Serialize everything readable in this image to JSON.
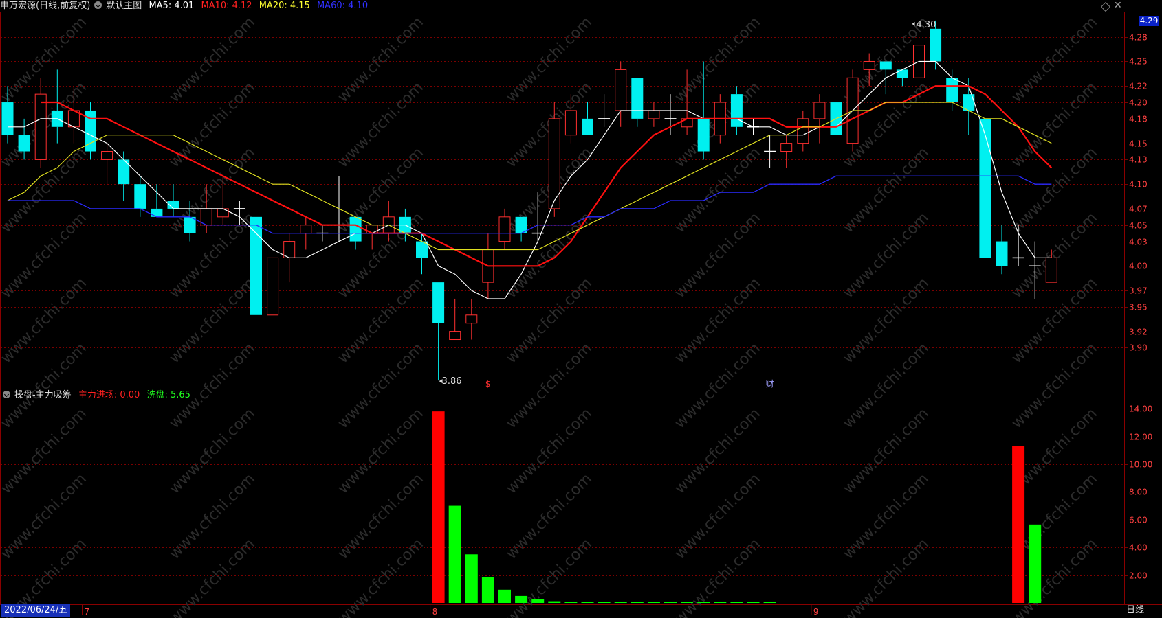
{
  "header": {
    "stock": "申万宏源(日线,前复权)",
    "main_chart": "默认主图",
    "ma5_label": "MA5:",
    "ma5_value": "4.01",
    "ma5_color": "#ffffff",
    "ma10_label": "MA10:",
    "ma10_value": "4.12",
    "ma10_color": "#ff2020",
    "ma20_label": "MA20:",
    "ma20_value": "4.15",
    "ma20_color": "#ffff30",
    "ma60_label": "MA60:",
    "ma60_value": "4.10",
    "ma60_color": "#2020ff"
  },
  "sub_header": {
    "indicator": "操盘-主力吸筹",
    "main_entry_label": "主力进场:",
    "main_entry_value": "0.00",
    "wash_label": "洗盘:",
    "wash_value": "5.65"
  },
  "current_price": "4.29",
  "date_label": "2022/06/24/五",
  "period_label": "日线",
  "month_ticks": [
    "7",
    "8",
    "9"
  ],
  "markers": {
    "high": "4.30",
    "low": "3.86",
    "event1": "$",
    "event2": "财"
  },
  "watermark": "www.cfchi.com",
  "colors": {
    "up": "#ff3030",
    "down": "#00f0f0",
    "grid": "#7a0000",
    "axis_text": "#ff4040",
    "bar_red": "#ff0000",
    "bar_green": "#00ff00"
  },
  "chart_data": [
    {
      "type": "candlestick",
      "title": "申万宏源(日线,前复权)",
      "ylim": [
        3.85,
        4.31
      ],
      "y_ticks": [
        "4.28",
        "4.25",
        "4.22",
        "4.20",
        "4.18",
        "4.15",
        "4.13",
        "4.10",
        "4.07",
        "4.05",
        "4.03",
        "4.00",
        "3.97",
        "3.95",
        "3.92",
        "3.90"
      ],
      "candles": [
        {
          "o": 4.2,
          "h": 4.22,
          "l": 4.15,
          "c": 4.16
        },
        {
          "o": 4.16,
          "h": 4.18,
          "l": 4.13,
          "c": 4.14
        },
        {
          "o": 4.13,
          "h": 4.23,
          "l": 4.12,
          "c": 4.21
        },
        {
          "o": 4.19,
          "h": 4.24,
          "l": 4.15,
          "c": 4.17
        },
        {
          "o": 4.17,
          "h": 4.22,
          "l": 4.15,
          "c": 4.19
        },
        {
          "o": 4.19,
          "h": 4.2,
          "l": 4.13,
          "c": 4.14
        },
        {
          "o": 4.13,
          "h": 4.15,
          "l": 4.1,
          "c": 4.14
        },
        {
          "o": 4.13,
          "h": 4.14,
          "l": 4.08,
          "c": 4.1
        },
        {
          "o": 4.1,
          "h": 4.11,
          "l": 4.06,
          "c": 4.07
        },
        {
          "o": 4.07,
          "h": 4.1,
          "l": 4.06,
          "c": 4.06
        },
        {
          "o": 4.08,
          "h": 4.1,
          "l": 4.06,
          "c": 4.07
        },
        {
          "o": 4.06,
          "h": 4.08,
          "l": 4.03,
          "c": 4.04
        },
        {
          "o": 4.05,
          "h": 4.1,
          "l": 4.04,
          "c": 4.07
        },
        {
          "o": 4.06,
          "h": 4.11,
          "l": 4.05,
          "c": 4.07
        },
        {
          "o": 4.07,
          "h": 4.08,
          "l": 4.05,
          "c": 4.07
        },
        {
          "o": 4.06,
          "h": 4.06,
          "l": 3.93,
          "c": 3.94
        },
        {
          "o": 3.94,
          "h": 4.01,
          "l": 3.94,
          "c": 4.01
        },
        {
          "o": 4.01,
          "h": 4.04,
          "l": 3.98,
          "c": 4.03
        },
        {
          "o": 4.04,
          "h": 4.06,
          "l": 4.02,
          "c": 4.05
        },
        {
          "o": 4.04,
          "h": 4.05,
          "l": 4.03,
          "c": 4.04
        },
        {
          "o": 4.05,
          "h": 4.11,
          "l": 4.03,
          "c": 4.05
        },
        {
          "o": 4.06,
          "h": 4.06,
          "l": 4.02,
          "c": 4.03
        },
        {
          "o": 4.04,
          "h": 4.05,
          "l": 4.02,
          "c": 4.05
        },
        {
          "o": 4.04,
          "h": 4.08,
          "l": 4.03,
          "c": 4.06
        },
        {
          "o": 4.06,
          "h": 4.07,
          "l": 4.03,
          "c": 4.04
        },
        {
          "o": 4.03,
          "h": 4.04,
          "l": 3.99,
          "c": 4.01
        },
        {
          "o": 3.98,
          "h": 3.98,
          "l": 3.86,
          "c": 3.93
        },
        {
          "o": 3.91,
          "h": 3.96,
          "l": 3.91,
          "c": 3.92
        },
        {
          "o": 3.93,
          "h": 3.96,
          "l": 3.91,
          "c": 3.94
        },
        {
          "o": 3.98,
          "h": 4.04,
          "l": 3.96,
          "c": 4.02
        },
        {
          "o": 4.03,
          "h": 4.07,
          "l": 4.02,
          "c": 4.06
        },
        {
          "o": 4.06,
          "h": 4.06,
          "l": 4.03,
          "c": 4.04
        },
        {
          "o": 4.04,
          "h": 4.09,
          "l": 4.03,
          "c": 4.04
        },
        {
          "o": 4.07,
          "h": 4.2,
          "l": 4.06,
          "c": 4.18
        },
        {
          "o": 4.16,
          "h": 4.21,
          "l": 4.15,
          "c": 4.19
        },
        {
          "o": 4.18,
          "h": 4.2,
          "l": 4.16,
          "c": 4.16
        },
        {
          "o": 4.18,
          "h": 4.21,
          "l": 4.17,
          "c": 4.18
        },
        {
          "o": 4.19,
          "h": 4.25,
          "l": 4.17,
          "c": 4.24
        },
        {
          "o": 4.23,
          "h": 4.23,
          "l": 4.17,
          "c": 4.18
        },
        {
          "o": 4.18,
          "h": 4.2,
          "l": 4.17,
          "c": 4.19
        },
        {
          "o": 4.18,
          "h": 4.21,
          "l": 4.16,
          "c": 4.18
        },
        {
          "o": 4.17,
          "h": 4.24,
          "l": 4.16,
          "c": 4.18
        },
        {
          "o": 4.18,
          "h": 4.25,
          "l": 4.13,
          "c": 4.14
        },
        {
          "o": 4.16,
          "h": 4.21,
          "l": 4.15,
          "c": 4.2
        },
        {
          "o": 4.21,
          "h": 4.22,
          "l": 4.16,
          "c": 4.17
        },
        {
          "o": 4.17,
          "h": 4.18,
          "l": 4.16,
          "c": 4.17
        },
        {
          "o": 4.14,
          "h": 4.16,
          "l": 4.12,
          "c": 4.14
        },
        {
          "o": 4.14,
          "h": 4.16,
          "l": 4.12,
          "c": 4.15
        },
        {
          "o": 4.15,
          "h": 4.19,
          "l": 4.14,
          "c": 4.18
        },
        {
          "o": 4.18,
          "h": 4.21,
          "l": 4.15,
          "c": 4.2
        },
        {
          "o": 4.2,
          "h": 4.2,
          "l": 4.16,
          "c": 4.16
        },
        {
          "o": 4.15,
          "h": 4.24,
          "l": 4.14,
          "c": 4.23
        },
        {
          "o": 4.24,
          "h": 4.26,
          "l": 4.22,
          "c": 4.25
        },
        {
          "o": 4.25,
          "h": 4.25,
          "l": 4.21,
          "c": 4.24
        },
        {
          "o": 4.24,
          "h": 4.24,
          "l": 4.22,
          "c": 4.23
        },
        {
          "o": 4.23,
          "h": 4.3,
          "l": 4.22,
          "c": 4.27
        },
        {
          "o": 4.29,
          "h": 4.3,
          "l": 4.24,
          "c": 4.25
        },
        {
          "o": 4.23,
          "h": 4.24,
          "l": 4.19,
          "c": 4.2
        },
        {
          "o": 4.21,
          "h": 4.23,
          "l": 4.16,
          "c": 4.19
        },
        {
          "o": 4.18,
          "h": 4.18,
          "l": 4.01,
          "c": 4.01
        },
        {
          "o": 4.03,
          "h": 4.05,
          "l": 3.99,
          "c": 4.0
        },
        {
          "o": 4.01,
          "h": 4.05,
          "l": 4.0,
          "c": 4.01
        },
        {
          "o": 4.0,
          "h": 4.03,
          "l": 3.96,
          "c": 4.0
        },
        {
          "o": 3.98,
          "h": 4.02,
          "l": 3.98,
          "c": 4.01
        }
      ],
      "series": [
        {
          "name": "MA5",
          "values": [
            4.17,
            4.17,
            4.18,
            4.18,
            4.17,
            4.16,
            4.15,
            4.13,
            4.11,
            4.09,
            4.07,
            4.07,
            4.07,
            4.07,
            4.06,
            4.04,
            4.02,
            4.01,
            4.01,
            4.02,
            4.03,
            4.04,
            4.04,
            4.05,
            4.05,
            4.04,
            4.0,
            3.99,
            3.97,
            3.96,
            3.96,
            3.99,
            4.03,
            4.08,
            4.11,
            4.13,
            4.16,
            4.19,
            4.19,
            4.19,
            4.19,
            4.19,
            4.18,
            4.18,
            4.18,
            4.17,
            4.17,
            4.16,
            4.16,
            4.17,
            4.17,
            4.19,
            4.21,
            4.23,
            4.24,
            4.25,
            4.25,
            4.23,
            4.22,
            4.16,
            4.09,
            4.04,
            4.01,
            4.01
          ]
        },
        {
          "name": "MA10",
          "values": [
            null,
            null,
            4.2,
            4.2,
            4.19,
            4.18,
            4.18,
            4.17,
            4.16,
            4.15,
            4.14,
            4.13,
            4.12,
            4.11,
            4.1,
            4.09,
            4.08,
            4.07,
            4.06,
            4.05,
            4.05,
            4.05,
            4.04,
            4.04,
            4.04,
            4.04,
            4.03,
            4.02,
            4.01,
            4.0,
            4.0,
            4.0,
            4.0,
            4.01,
            4.03,
            4.06,
            4.09,
            4.12,
            4.14,
            4.16,
            4.17,
            4.18,
            4.18,
            4.18,
            4.18,
            4.18,
            4.18,
            4.17,
            4.17,
            4.17,
            4.17,
            4.18,
            4.19,
            4.2,
            4.2,
            4.21,
            4.22,
            4.22,
            4.22,
            4.21,
            4.19,
            4.17,
            4.14,
            4.12
          ]
        },
        {
          "name": "MA20",
          "values": [
            4.08,
            4.09,
            4.11,
            4.12,
            4.14,
            4.15,
            4.16,
            4.16,
            4.16,
            4.16,
            4.16,
            4.15,
            4.14,
            4.13,
            4.12,
            4.11,
            4.1,
            4.1,
            4.09,
            4.08,
            4.07,
            4.06,
            4.05,
            4.05,
            4.04,
            4.03,
            4.02,
            4.02,
            4.02,
            4.02,
            4.02,
            4.02,
            4.02,
            4.03,
            4.04,
            4.05,
            4.06,
            4.07,
            4.08,
            4.09,
            4.1,
            4.11,
            4.12,
            4.13,
            4.14,
            4.15,
            4.16,
            4.16,
            4.17,
            4.17,
            4.18,
            4.19,
            4.19,
            4.2,
            4.2,
            4.2,
            4.2,
            4.2,
            4.19,
            4.18,
            4.18,
            4.17,
            4.16,
            4.15
          ]
        },
        {
          "name": "MA60",
          "values": [
            4.08,
            4.08,
            4.08,
            4.08,
            4.08,
            4.07,
            4.07,
            4.07,
            4.07,
            4.06,
            4.06,
            4.06,
            4.05,
            4.05,
            4.05,
            4.05,
            4.04,
            4.04,
            4.04,
            4.04,
            4.04,
            4.04,
            4.04,
            4.04,
            4.04,
            4.04,
            4.04,
            4.04,
            4.04,
            4.04,
            4.04,
            4.04,
            4.05,
            4.05,
            4.05,
            4.06,
            4.06,
            4.07,
            4.07,
            4.07,
            4.08,
            4.08,
            4.08,
            4.09,
            4.09,
            4.09,
            4.1,
            4.1,
            4.1,
            4.1,
            4.11,
            4.11,
            4.11,
            4.11,
            4.11,
            4.11,
            4.11,
            4.11,
            4.11,
            4.11,
            4.11,
            4.11,
            4.1,
            4.1
          ]
        }
      ]
    },
    {
      "type": "bar",
      "title": "操盘-主力吸筹",
      "ylim": [
        0,
        14.5
      ],
      "y_ticks": [
        "14.00",
        "12.00",
        "10.00",
        "8.00",
        "6.00",
        "4.00",
        "2.00"
      ],
      "series": [
        {
          "name": "主力进场",
          "color": "#ff0000",
          "bars": [
            {
              "i": 26,
              "v": 13.8
            },
            {
              "i": 61,
              "v": 11.3
            }
          ]
        },
        {
          "name": "洗盘",
          "color": "#00ff00",
          "bars": [
            {
              "i": 27,
              "v": 7.0
            },
            {
              "i": 28,
              "v": 3.5
            },
            {
              "i": 29,
              "v": 1.85
            },
            {
              "i": 30,
              "v": 0.95
            },
            {
              "i": 31,
              "v": 0.5
            },
            {
              "i": 32,
              "v": 0.25
            },
            {
              "i": 33,
              "v": 0.12
            },
            {
              "i": 34,
              "v": 0.08
            },
            {
              "i": 35,
              "v": 0.05
            },
            {
              "i": 36,
              "v": 0.05
            },
            {
              "i": 37,
              "v": 0.05
            },
            {
              "i": 38,
              "v": 0.05
            },
            {
              "i": 39,
              "v": 0.05
            },
            {
              "i": 40,
              "v": 0.05
            },
            {
              "i": 41,
              "v": 0.05
            },
            {
              "i": 42,
              "v": 0.05
            },
            {
              "i": 43,
              "v": 0.05
            },
            {
              "i": 44,
              "v": 0.05
            },
            {
              "i": 45,
              "v": 0.05
            },
            {
              "i": 46,
              "v": 0.05
            },
            {
              "i": 62,
              "v": 5.65
            }
          ]
        }
      ]
    }
  ]
}
